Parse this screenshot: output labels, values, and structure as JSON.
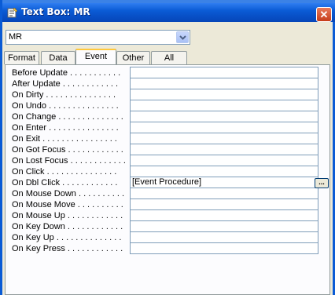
{
  "window": {
    "title": "Text Box: MR",
    "icon": "properties-sheet-icon"
  },
  "selector": {
    "value": "MR"
  },
  "tabs": [
    {
      "label": "Format",
      "active": false
    },
    {
      "label": "Data",
      "active": false
    },
    {
      "label": "Event",
      "active": true
    },
    {
      "label": "Other",
      "active": false
    },
    {
      "label": "All",
      "active": false
    }
  ],
  "properties": [
    {
      "label": "Before Update . . . . . . . . . . .",
      "value": ""
    },
    {
      "label": "After Update . . . . . . . . . . . .",
      "value": ""
    },
    {
      "label": "On Dirty . . . . . . . . . . . . . . .",
      "value": ""
    },
    {
      "label": "On Undo . . . . . . . . . . . . . . .",
      "value": ""
    },
    {
      "label": "On Change . . . . . . . . . . . . . .",
      "value": ""
    },
    {
      "label": "On Enter . . . . . . . . . . . . . . .",
      "value": ""
    },
    {
      "label": "On Exit . . . . . . . . . . . . . . . .",
      "value": ""
    },
    {
      "label": "On Got Focus . . . . . . . . . . . .",
      "value": ""
    },
    {
      "label": "On Lost Focus . . . . . . . . . . . .",
      "value": ""
    },
    {
      "label": "On Click . . . . . . . . . . . . . . .",
      "value": ""
    },
    {
      "label": "On Dbl Click . . . . . . . . . . . .",
      "value": "[Event Procedure]"
    },
    {
      "label": "On Mouse Down . . . . . . . . . .",
      "value": ""
    },
    {
      "label": "On Mouse Move . . . . . . . . . .",
      "value": ""
    },
    {
      "label": "On Mouse Up . . . . . . . . . . . .",
      "value": ""
    },
    {
      "label": "On Key Down . . . . . . . . . . . .",
      "value": ""
    },
    {
      "label": "On Key Up . . . . . . . . . . . . . .",
      "value": ""
    },
    {
      "label": "On Key Press . . . . . . . . . . . .",
      "value": ""
    }
  ],
  "builder_button": {
    "label": "..."
  },
  "colors": {
    "titlebar": "#0a5bd5",
    "active_tab_accent": "#ffc83c",
    "close_button": "#c63d1a"
  }
}
